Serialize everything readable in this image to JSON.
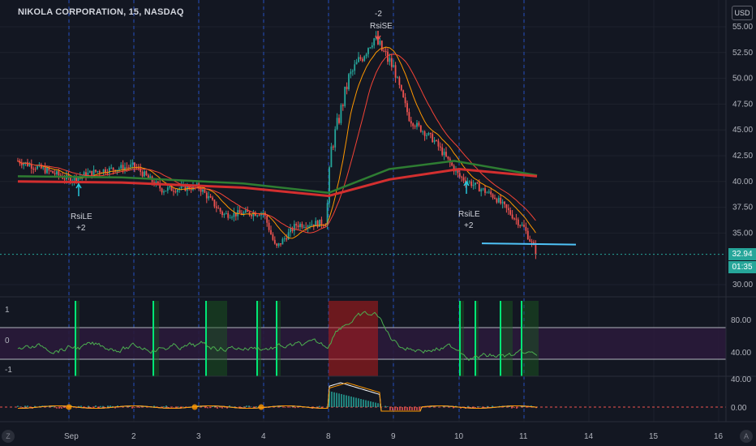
{
  "header": {
    "title": "NIKOLA CORPORATION, 15, NASDAQ",
    "currency": "USD"
  },
  "price_tags": {
    "last_price": "32.94",
    "countdown": "01:35"
  },
  "corners": {
    "left": "Z",
    "right": "A"
  },
  "colors": {
    "background": "#131722",
    "up_candle": "#26a69a",
    "down_candle": "#ef5350",
    "red_ma": "#f44336",
    "orange_ma": "#ff9800",
    "slow_red_ma": "#d32f2f",
    "slow_green_ma": "#2e7d32",
    "cyan_line": "#4fc3f7",
    "rsi_line": "#4caf50",
    "rsi_band": "#2a1a3a",
    "macd_line": "#ffffff",
    "signal_line": "#ff9800"
  },
  "chart_data": [
    {
      "type": "candlestick",
      "panel": "price",
      "title": "NIKOLA CORPORATION, 15, NASDAQ",
      "x_ticks": [
        "Sep",
        "2",
        "3",
        "4",
        "8",
        "9",
        "10",
        "11",
        "14",
        "15",
        "16"
      ],
      "y_ticks": [
        "55.00",
        "52.50",
        "50.00",
        "47.50",
        "45.00",
        "42.50",
        "40.00",
        "37.50",
        "35.00",
        "30.00"
      ],
      "ylim": [
        28.5,
        55.5
      ],
      "price_path": [
        [
          "8/31",
          42
        ],
        [
          "8/31 mid",
          41.2
        ],
        [
          "Sep",
          40.2
        ],
        [
          "Sep mid",
          41.0
        ],
        [
          "2",
          41.5
        ],
        [
          "2 mid",
          39.2
        ],
        [
          "3",
          39.5
        ],
        [
          "3 mid",
          36.8
        ],
        [
          "4",
          37.0
        ],
        [
          "4 mid",
          33.5
        ],
        [
          "4 late",
          35.8
        ],
        [
          "8",
          36.0
        ],
        [
          "8 open",
          43.0
        ],
        [
          "8 mid",
          50.0
        ],
        [
          "8 late",
          54.0
        ],
        [
          "9",
          51.0
        ],
        [
          "9 mid",
          46.0
        ],
        [
          "9 late",
          44.0
        ],
        [
          "10",
          40.5
        ],
        [
          "10 mid",
          38.5
        ],
        [
          "11",
          35.5
        ],
        [
          "11 last",
          32.94
        ]
      ],
      "annotations": [
        {
          "label": "-2",
          "sublabel": "RsiSE",
          "at": "8 late",
          "direction": "down"
        },
        {
          "label": "RsiLE",
          "sublabel": "+2",
          "at": "Sep",
          "direction": "up"
        },
        {
          "label": "RsiLE",
          "sublabel": "+2",
          "at": "10",
          "direction": "up"
        }
      ],
      "horizontal_line": 34.0
    },
    {
      "type": "line",
      "panel": "rsi",
      "y_ticks_left": [
        "1",
        "0",
        "-1"
      ],
      "y_ticks_right": [
        "80.00",
        "40.00"
      ],
      "upper_band": 80,
      "lower_band": 40,
      "highlight_zones": [
        {
          "from": "Sep",
          "color": "green"
        },
        {
          "from": "2",
          "color": "green"
        },
        {
          "from": "3",
          "color": "green"
        },
        {
          "from": "4",
          "color": "green"
        },
        {
          "from": "8",
          "to": "9",
          "color": "red"
        },
        {
          "from": "10",
          "color": "green"
        },
        {
          "from": "11",
          "color": "green"
        }
      ]
    },
    {
      "type": "line",
      "panel": "macd",
      "y_ticks": [
        "40.00",
        "0.00"
      ],
      "series": [
        {
          "values_desc": "near zero, peak after 8",
          "color": "white"
        },
        {
          "values_desc": "signal",
          "color": "orange"
        }
      ]
    }
  ]
}
